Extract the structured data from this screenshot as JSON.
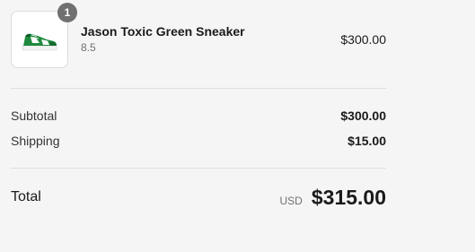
{
  "cart": {
    "items": [
      {
        "quantity": "1",
        "name": "Jason Toxic Green Sneaker",
        "variant": "8.5",
        "price": "$300.00",
        "image_icon": "green-sneaker-icon"
      }
    ]
  },
  "summary": {
    "subtotal_label": "Subtotal",
    "subtotal_value": "$300.00",
    "shipping_label": "Shipping",
    "shipping_value": "$15.00",
    "total_label": "Total",
    "currency": "USD",
    "total_value": "$315.00"
  },
  "colors": {
    "background": "#f5f5f5",
    "badge": "#707070",
    "sneaker_green": "#1f8a3e",
    "divider": "#dedede"
  }
}
